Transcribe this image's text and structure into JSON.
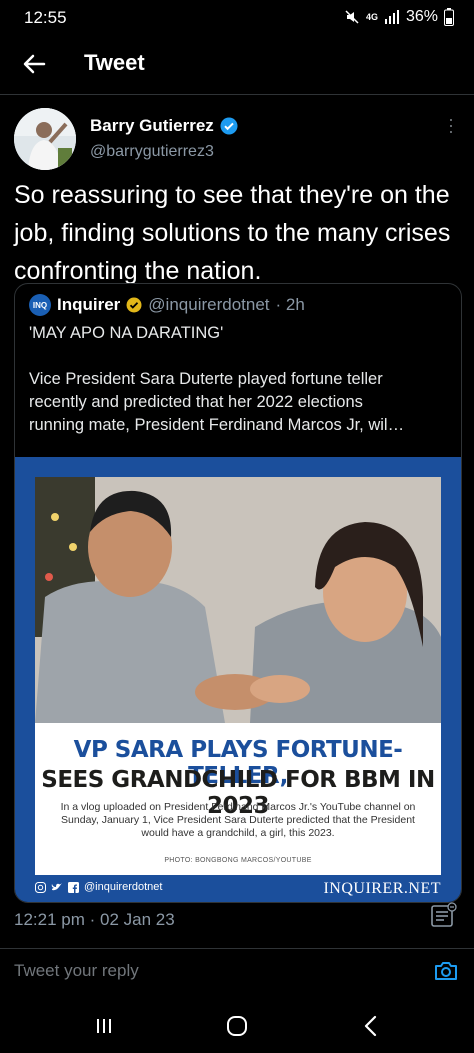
{
  "status_bar": {
    "time": "12:55",
    "network": "4G",
    "battery": "36%"
  },
  "header": {
    "title": "Tweet"
  },
  "tweet": {
    "author_name": "Barry Gutierrez",
    "author_handle": "@barrygutierrez3",
    "text": "So reassuring to see that they're on the job, finding solutions to the many crises confronting the nation.",
    "timestamp": "12:21 pm · 02 Jan 23"
  },
  "quoted_tweet": {
    "logo_text": "INQ",
    "author_name": "Inquirer",
    "author_handle": "@inquirerdotnet",
    "age": "· 2h",
    "line1": "'MAY APO NA DARATING'",
    "line2": "Vice President Sara Duterte played fortune teller",
    "line3": "recently and predicted that her 2022 elections",
    "line4": "running mate, President Ferdinand Marcos Jr, wil…",
    "card": {
      "headline_1": "VP SARA PLAYS FORTUNE-TELLER,",
      "headline_2": "SEES GRANDCHILD FOR BBM IN 2023",
      "subtext": "In a vlog uploaded on President Ferdinand Marcos Jr.'s YouTube channel on Sunday, January 1, Vice President Sara Duterte predicted that the President would have a grandchild, a girl, this 2023.",
      "credit": "PHOTO: BONGBONG MARCOS/YOUTUBE",
      "social_handle": "@inquirerdotnet",
      "brand": "INQUIRER.NET",
      "brand_color": "#1b4f9c"
    }
  },
  "reply": {
    "placeholder": "Tweet your reply"
  },
  "colors": {
    "verified": "#1d9bf0",
    "accent": "#1d9bf0",
    "muted": "#8b98a5"
  }
}
